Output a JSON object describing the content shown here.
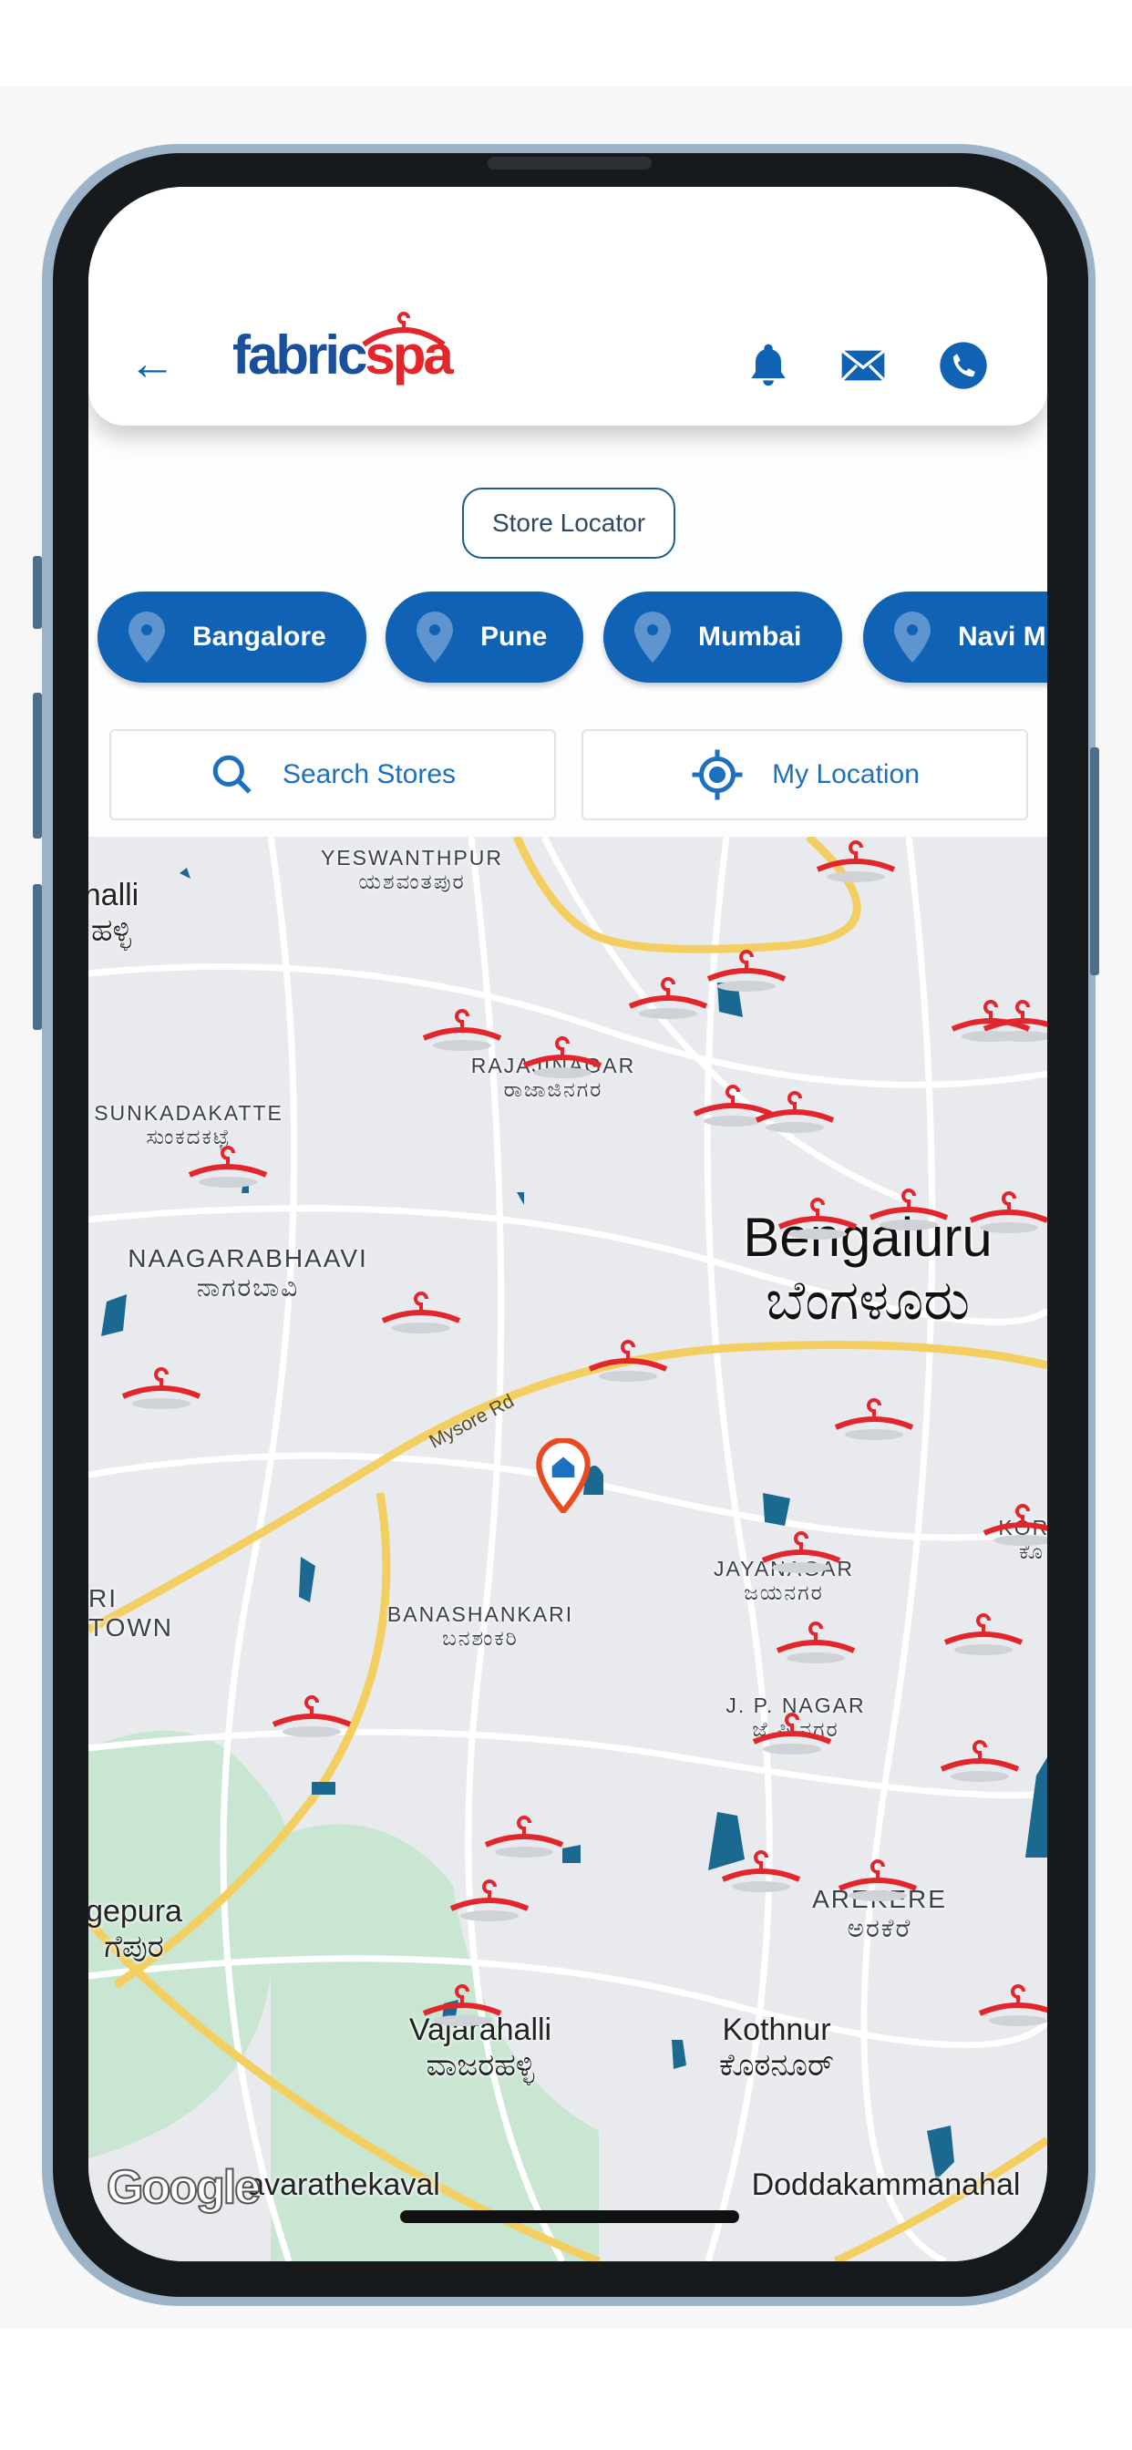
{
  "header": {
    "back_icon": "arrow-left-icon",
    "logo_part1": "fabric",
    "logo_part2": "spa",
    "icons": [
      "bell-icon",
      "mail-icon",
      "phone-icon"
    ]
  },
  "store_locator_label": "Store Locator",
  "cities": [
    "Bangalore",
    "Pune",
    "Mumbai",
    "Navi Mumbai"
  ],
  "search_label": "Search Stores",
  "my_location_label": "My Location",
  "map": {
    "labels": {
      "yeswanthpur": "YESWANTHPUR",
      "yeswanthpur_kn": "ಯಶವಂತಪುರ",
      "halli": "halli",
      "halli_kn": "ಹಳ್ಳಿ",
      "rajajinagar": "RAJAJINAGAR",
      "rajajinagar_kn": "ರಾಜಾಜಿನಗರ",
      "sunkadakatte": "SUNKADAKATTE",
      "sunkadakatte_kn": "ಸುಂಕದಕಟ್ಟೆ",
      "naagarabhaavi": "NAAGARABHAAVI",
      "naagarabhaavi_kn": "ನಾಗರಬಾವಿ",
      "bengaluru": "Bengaluru",
      "bengaluru_kn": "ಬೆಂಗಳೂರು",
      "mysore_rd": "Mysore Rd",
      "ri_town": "RI",
      "town": "TOWN",
      "kora": "KORA",
      "kora_kn": "ಕೊ",
      "banashankari": "BANASHANKARI",
      "banashankari_kn": "ಬನಶಂಕರಿ",
      "jayanagar": "JAYANAGAR",
      "jayanagar_kn": "ಜಯನಗರ",
      "jpnagar": "J. P. NAGAR",
      "jpnagar_kn": "ಜೆ ಪಿ ನಗರ",
      "arekere": "AREKERE",
      "arekere_kn": "ಅರಕೆರೆ",
      "gepura": "gepura",
      "gepura_kn": "ಗೆಪುರ",
      "vajarahalli": "Vajarahalli",
      "vajarahalli_kn": "ವಾಜರಹಳ್ಳಿ",
      "kothnur": "Kothnur",
      "kothnur_kn": "ಕೊಠನೂರ್",
      "avarathekaval": "avarathekaval",
      "doddakammanahalli": "Doddakammanahal",
      "google": "Google"
    },
    "store_marker_icon": "hanger-icon",
    "user_marker_icon": "home-pin-icon",
    "marker_color": "#e3262b",
    "accent": "#1062b4"
  }
}
